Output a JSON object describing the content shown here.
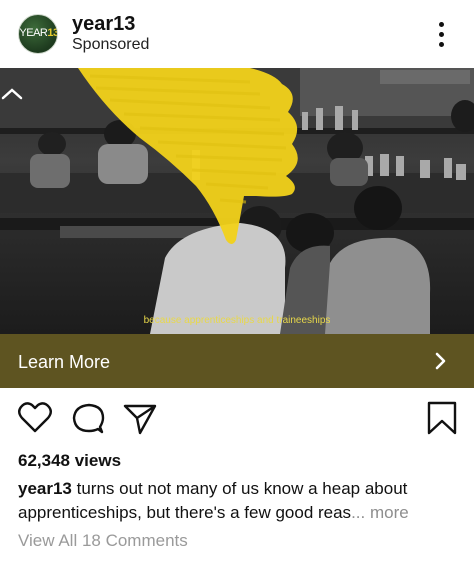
{
  "post": {
    "account": {
      "name": "year13",
      "subtitle": "Sponsored",
      "avatar_logo_prefix": "YEAR",
      "avatar_logo_suffix": "13"
    },
    "media": {
      "caption": "because apprenticeships and traineeships",
      "overlay_icon": "thumbs-down-icon",
      "overlay_color": "#f2d21a"
    },
    "cta": {
      "label": "Learn More",
      "color": "#5e5421"
    },
    "views": "62,348 views",
    "description": {
      "username": "year13",
      "text": "turns out not many of us know a heap about apprenticeships, but there's a few good reas",
      "ellipsis": "...",
      "more_label": "more"
    },
    "comments_link": "View All 18 Comments"
  }
}
